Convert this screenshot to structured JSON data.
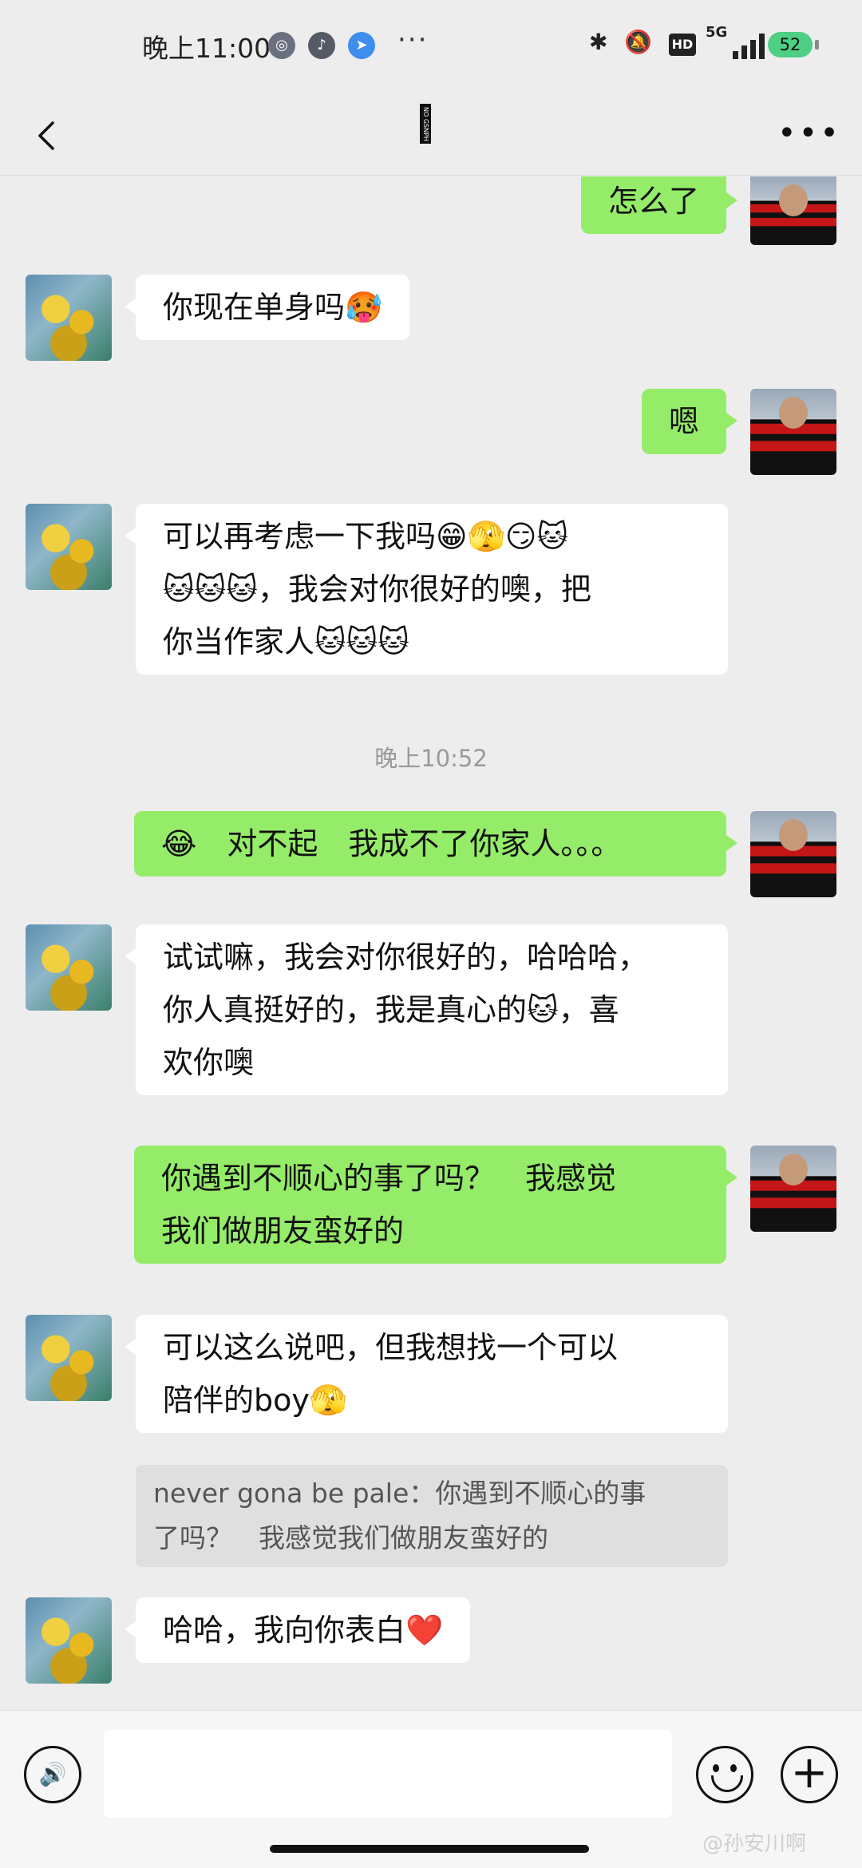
{
  "status_bar": {
    "time": "晚上11:00",
    "more": "···",
    "bluetooth": "✱",
    "mute": "🔕",
    "hd": "HD",
    "network": "5G",
    "battery": "52",
    "signal_level": 4
  },
  "header": {
    "title": "NO GSNPH",
    "back_icon": "chevron-left-icon",
    "more_icon": "more-dots-icon"
  },
  "messages": [
    {
      "side": "out",
      "text": "怎么了"
    },
    {
      "side": "in",
      "text": "你现在单身吗🥵"
    },
    {
      "side": "out",
      "text": "嗯"
    },
    {
      "side": "in",
      "lines": [
        "可以再考虑一下我吗😁🫣😏🐱",
        "🐱🐱🐱，我会对你很好的噢，把",
        "你当作家人🐱🐱🐱"
      ]
    },
    {
      "side": "time",
      "text": "晚上10:52"
    },
    {
      "side": "out",
      "text": "😂　对不起　我成不了你家人。。。"
    },
    {
      "side": "in",
      "lines": [
        "试试嘛，我会对你很好的，哈哈哈，",
        "你人真挺好的，我是真心的🐱，喜",
        "欢你噢"
      ]
    },
    {
      "side": "out",
      "lines": [
        "你遇到不顺心的事了吗？　我感觉",
        "我们做朋友蛮好的"
      ]
    },
    {
      "side": "in",
      "lines": [
        "可以这么说吧，但我想找一个可以",
        "陪伴的boy🫣"
      ]
    },
    {
      "side": "quote",
      "lines": [
        "never gona be pale：你遇到不顺心的事",
        "了吗？　我感觉我们做朋友蛮好的"
      ]
    },
    {
      "side": "in",
      "text": "哈哈，我向你表白❤️"
    }
  ],
  "input": {
    "placeholder": "",
    "voice_icon": "🔊"
  },
  "watermark": "@孙安川啊"
}
